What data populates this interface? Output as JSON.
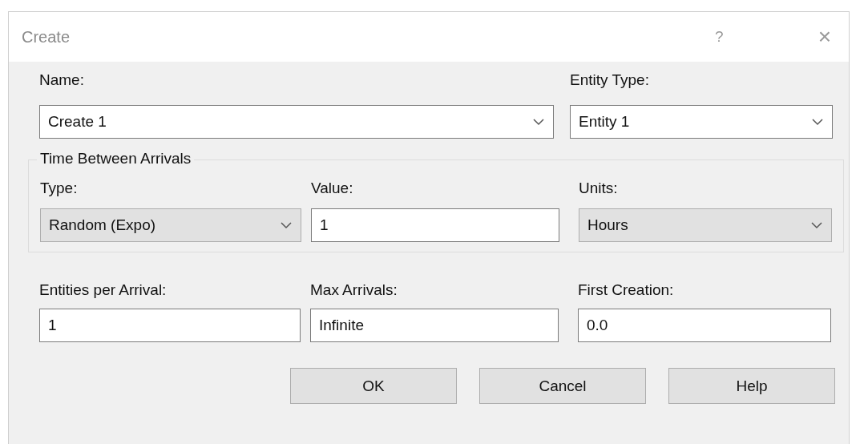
{
  "window": {
    "title": "Create",
    "help": "?",
    "close": "×"
  },
  "top_fields": [
    {
      "label": "Name:",
      "value": "Create 1",
      "kind": "combo"
    },
    {
      "label": "Entity Type:",
      "value": "Entity 1",
      "kind": "combo"
    }
  ],
  "group": {
    "title": "Time Between Arrivals",
    "fields": [
      {
        "label": "Type:",
        "value": "Random (Expo)",
        "kind": "dropdown"
      },
      {
        "label": "Value:",
        "value": "1",
        "kind": "text"
      },
      {
        "label": "Units:",
        "value": "Hours",
        "kind": "dropdown"
      }
    ]
  },
  "bottom_fields": [
    {
      "label": "Entities per Arrival:",
      "value": "1",
      "kind": "text"
    },
    {
      "label": "Max Arrivals:",
      "value": "Infinite",
      "kind": "text"
    },
    {
      "label": "First Creation:",
      "value": "0.0",
      "kind": "text"
    }
  ],
  "buttons": [
    "OK",
    "Cancel",
    "Help"
  ]
}
